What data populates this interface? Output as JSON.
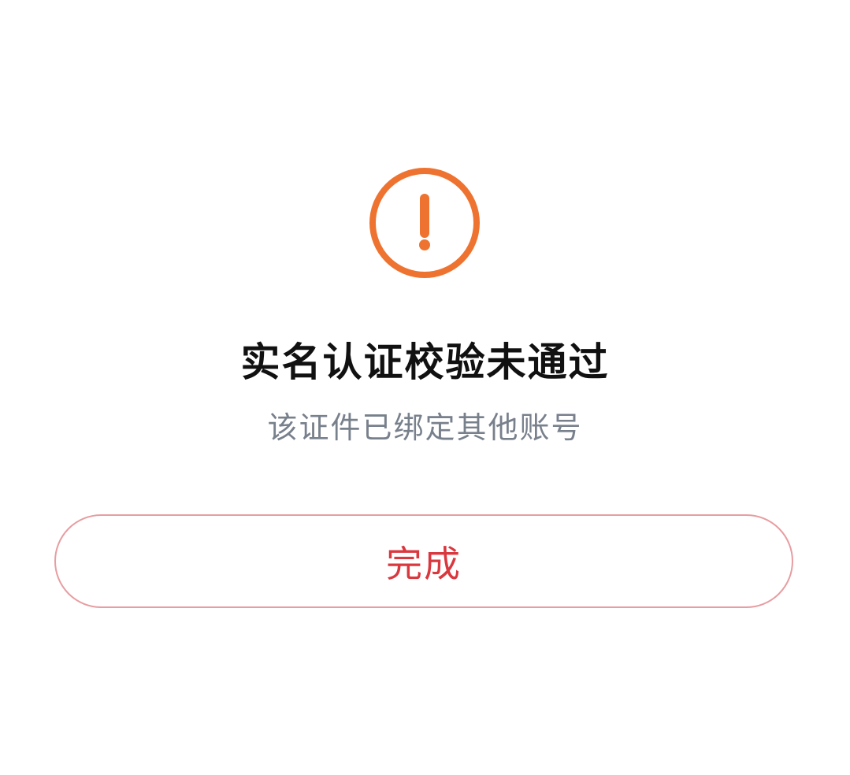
{
  "result": {
    "icon": "alert-circle-icon",
    "icon_color": "#ee7330",
    "title": "实名认证校验未通过",
    "message": "该证件已绑定其他账号"
  },
  "actions": {
    "done_label": "完成",
    "accent_color": "#d9383f",
    "border_color": "#e79da1"
  }
}
